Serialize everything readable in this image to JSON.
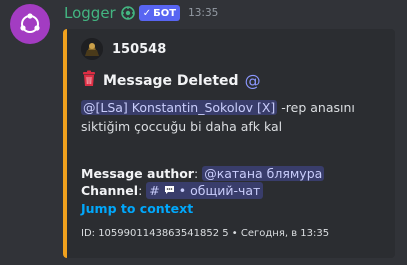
{
  "message": {
    "bot_name": "Logger",
    "badge": "БОТ",
    "badge_check": "✓",
    "timestamp": "13:35"
  },
  "embed": {
    "author": "150548",
    "title": "Message Deleted",
    "title_suffix": "@",
    "mention_user": "@[LSa] Konstantin_Sokolov [X]",
    "content_text": " -rep anasını siktiğim çoccuğu bi daha afk kal",
    "fields": {
      "author_label": "Message author",
      "author_value": "@катана блямура",
      "channel_label": "Channel",
      "channel_value": "• общий-чат",
      "channel_hash": "#",
      "colon": ":"
    },
    "jump_link": "Jump to context",
    "footer": "ID: 1059901143863541852 5 • Сегодня, в 13:35"
  },
  "colors": {
    "accent_bar": "#f0a11e",
    "bot_name": "#43b581",
    "badge": "#5865f2",
    "link": "#00a8fc",
    "mention_bg": "#5865f24d"
  },
  "icons": {
    "avatar": "bot-avatar-logo",
    "verified": "shield-emblem-icon",
    "trash": "trash-icon",
    "chat": "speech-bubble-icon"
  }
}
